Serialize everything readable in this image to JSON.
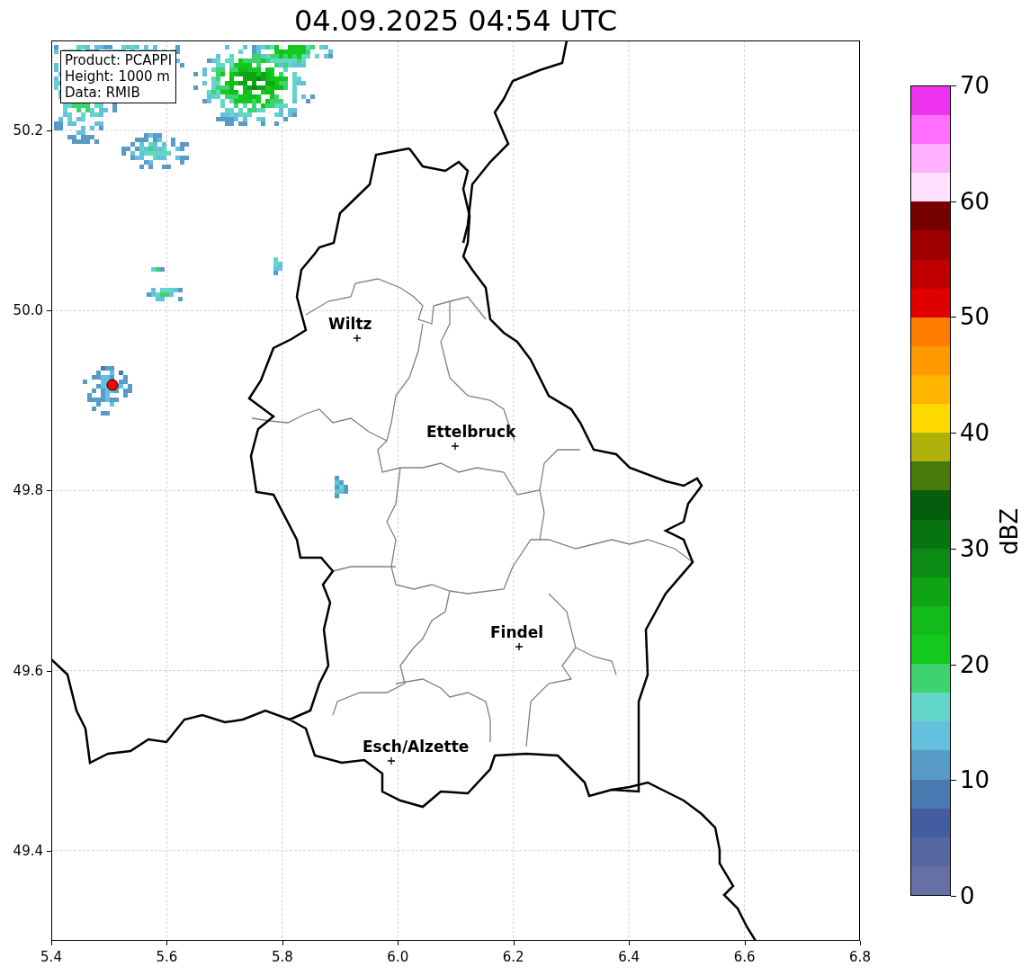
{
  "title": "04.09.2025 04:54 UTC",
  "info_box": [
    "Product: PCAPPI",
    "Height: 1000 m",
    "Data: RMIB"
  ],
  "x_ticks": [
    "5.4",
    "5.6",
    "5.8",
    "6.0",
    "6.2",
    "6.4",
    "6.6",
    "6.8"
  ],
  "y_ticks": [
    "50.2",
    "50.0",
    "49.8",
    "49.6",
    "49.4"
  ],
  "cities": [
    {
      "name": "Wiltz"
    },
    {
      "name": "Ettelbruck"
    },
    {
      "name": "Findel"
    },
    {
      "name": "Esch/Alzette"
    }
  ],
  "colorbar": {
    "label": "dBZ",
    "ticks": [
      "70",
      "60",
      "50",
      "40",
      "30",
      "20",
      "10",
      "0"
    ],
    "bins": [
      {
        "color": "#6470a6"
      },
      {
        "color": "#55679f"
      },
      {
        "color": "#445da0"
      },
      {
        "color": "#4a78b0"
      },
      {
        "color": "#589bc6"
      },
      {
        "color": "#64c0dc"
      },
      {
        "color": "#62d6c8"
      },
      {
        "color": "#3dd36e"
      },
      {
        "color": "#12c91c"
      },
      {
        "color": "#12bb1a"
      },
      {
        "color": "#0ea414"
      },
      {
        "color": "#0b8b14"
      },
      {
        "color": "#08740f"
      },
      {
        "color": "#065d0d"
      },
      {
        "color": "#477a0a"
      },
      {
        "color": "#b0b00a"
      },
      {
        "color": "#ffd800"
      },
      {
        "color": "#ffb400"
      },
      {
        "color": "#ff9900"
      },
      {
        "color": "#ff7d00"
      },
      {
        "color": "#e00000"
      },
      {
        "color": "#c00000"
      },
      {
        "color": "#9e0000"
      },
      {
        "color": "#760000"
      },
      {
        "color": "#ffe0ff"
      },
      {
        "color": "#ffb0ff"
      },
      {
        "color": "#ff6eff"
      },
      {
        "color": "#ee33ee"
      }
    ]
  }
}
